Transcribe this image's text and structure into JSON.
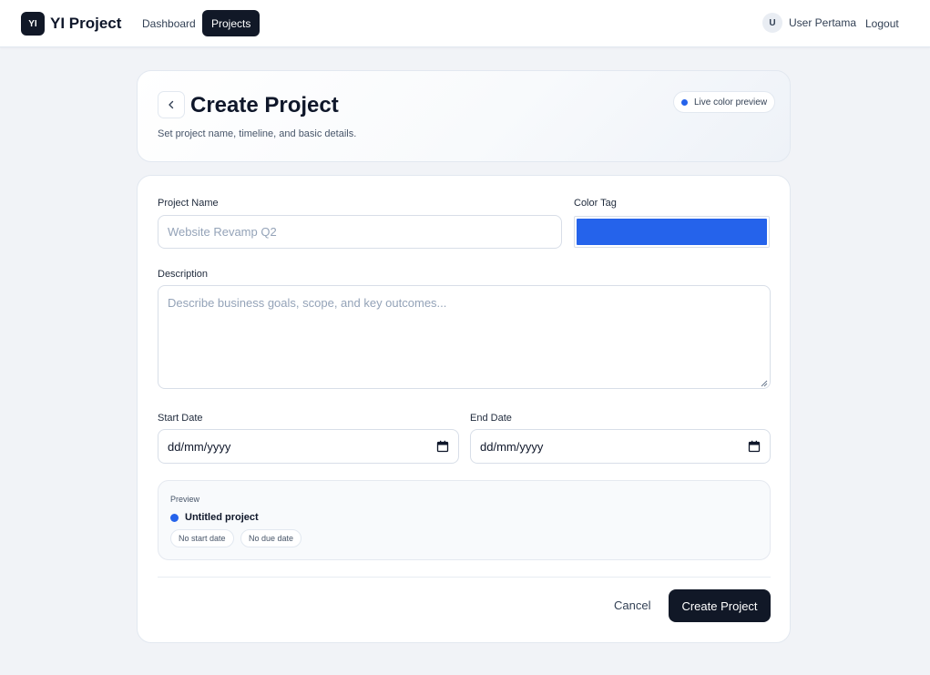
{
  "nav": {
    "brand_logo": "YI",
    "brand_name": "YI Project",
    "items": [
      {
        "label": "Dashboard",
        "active": false
      },
      {
        "label": "Projects",
        "active": true
      }
    ],
    "user_initial": "U",
    "user_name": "User Pertama",
    "logout_label": "Logout"
  },
  "header": {
    "back_icon": "chevron-left-icon",
    "title": "Create Project",
    "subtitle": "Set project name, timeline, and basic details.",
    "live_preview_label": "Live color preview"
  },
  "form": {
    "project_name": {
      "label": "Project Name",
      "placeholder": "Website Revamp Q2",
      "value": ""
    },
    "color_tag": {
      "label": "Color Tag",
      "value": "#2563eb"
    },
    "description": {
      "label": "Description",
      "placeholder": "Describe business goals, scope, and key outcomes...",
      "value": ""
    },
    "start_date": {
      "label": "Start Date",
      "placeholder": "dd/mm/yyyy"
    },
    "end_date": {
      "label": "End Date",
      "placeholder": "dd/mm/yyyy"
    }
  },
  "preview": {
    "label": "Preview",
    "title": "Untitled project",
    "start_chip": "No start date",
    "due_chip": "No due date"
  },
  "actions": {
    "cancel_label": "Cancel",
    "create_label": "Create Project"
  },
  "colors": {
    "accent": "#2563eb",
    "dark": "#111827"
  }
}
